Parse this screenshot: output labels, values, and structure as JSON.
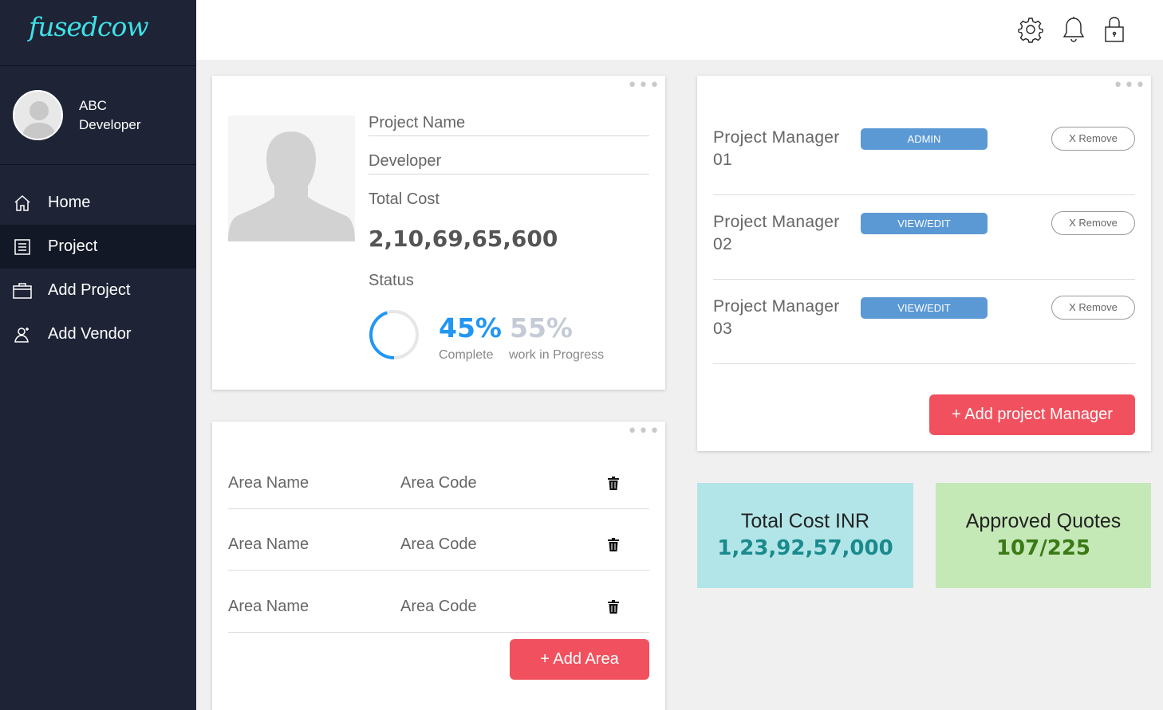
{
  "app": {
    "logo": "fusedcow"
  },
  "user": {
    "name": "ABC",
    "role": "Developer"
  },
  "nav": [
    {
      "label": "Home",
      "icon": "home-icon"
    },
    {
      "label": "Project",
      "icon": "list-icon",
      "active": true
    },
    {
      "label": "Add Project",
      "icon": "briefcase-icon"
    },
    {
      "label": "Add Vendor",
      "icon": "user-add-icon"
    }
  ],
  "topbar": {
    "icons": [
      "gear-icon",
      "bell-icon",
      "lock-icon"
    ]
  },
  "project": {
    "name_placeholder": "Project Name",
    "developer_placeholder": "Developer",
    "total_cost_label": "Total Cost",
    "total_cost_value": "2,10,69,65,600",
    "status_label": "Status",
    "complete_pct": "45%",
    "complete_label": "Complete",
    "progress_pct": "55%",
    "progress_label": "work in Progress",
    "complete_fraction": 0.45
  },
  "managers": [
    {
      "line1": "Project Manager",
      "line2": "01",
      "role": "ADMIN",
      "remove": "X Remove"
    },
    {
      "line1": "Project Manager",
      "line2": "02",
      "role": "VIEW/EDIT",
      "remove": "X Remove"
    },
    {
      "line1": "Project Manager",
      "line2": "03",
      "role": "VIEW/EDIT",
      "remove": "X Remove"
    }
  ],
  "add_manager_label": "+ Add project Manager",
  "areas": [
    {
      "name": "Area Name",
      "code": "Area Code"
    },
    {
      "name": "Area Name",
      "code": "Area Code"
    },
    {
      "name": "Area Name",
      "code": "Area Code"
    }
  ],
  "add_area_label": "+ Add Area",
  "stats": {
    "total_cost_label": "Total Cost INR",
    "total_cost_value": "1,23,92,57,000",
    "approved_label": "Approved Quotes",
    "approved_value": "107/225"
  },
  "colors": {
    "sidebar": "#1e2436",
    "accent_blue": "#2196f3",
    "role_button": "#5b99d5",
    "red_button": "#f1515e",
    "stat_cyan": "#b2e5e8",
    "stat_green": "#c5e8b7",
    "cyan_value": "#1a8a8c",
    "green_value": "#3a7a16",
    "logo": "#3de1e6"
  }
}
